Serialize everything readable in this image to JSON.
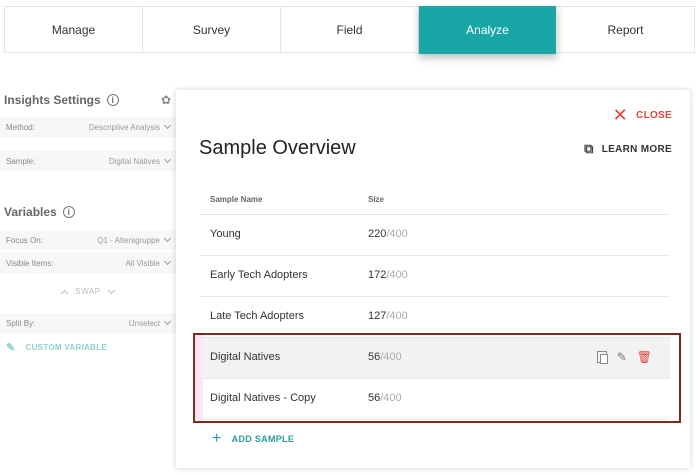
{
  "nav": {
    "tabs": [
      {
        "label": "Manage",
        "active": false
      },
      {
        "label": "Survey",
        "active": false
      },
      {
        "label": "Field",
        "active": false
      },
      {
        "label": "Analyze",
        "active": true
      },
      {
        "label": "Report",
        "active": false
      }
    ],
    "active_color": "#1aa6a6"
  },
  "sidebar": {
    "insights_title": "Insights Settings",
    "method_label": "Method:",
    "method_value": "Descriptive Analysis",
    "sample_label": "Sample:",
    "sample_value": "Digital Natives",
    "variables_title": "Variables",
    "focus_label": "Focus On:",
    "focus_value": "Q1 - Altersgruppe",
    "visible_label": "Visible Items:",
    "visible_value": "All Visible",
    "swap_label": "SWAP",
    "split_label": "Split By:",
    "split_value": "Unselect",
    "custom_variable_label": "CUSTOM VARIABLE"
  },
  "panel": {
    "close_label": "CLOSE",
    "title": "Sample Overview",
    "learn_more_label": "LEARN MORE",
    "columns": {
      "name": "Sample Name",
      "size": "Size"
    },
    "rows": [
      {
        "name": "Young",
        "size": "220",
        "total": "/400"
      },
      {
        "name": "Early Tech Adopters",
        "size": "172",
        "total": "/400"
      },
      {
        "name": "Late Tech Adopters",
        "size": "127",
        "total": "/400"
      },
      {
        "name": "Digital Natives",
        "size": "56",
        "total": "/400"
      },
      {
        "name": "Digital Natives - Copy",
        "size": "56",
        "total": "/400"
      }
    ],
    "add_sample_label": "ADD SAMPLE"
  },
  "colors": {
    "accent": "#1aa6a6",
    "danger": "#e0463e",
    "highlight_border": "#7a2d1a"
  }
}
